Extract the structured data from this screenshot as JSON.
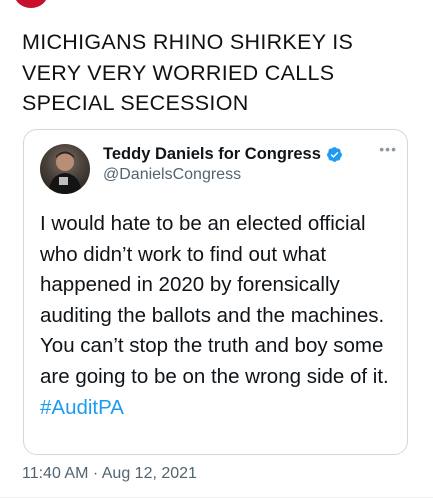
{
  "tweet": {
    "text": "Michigans RHINO Shirkey is very very worried calls special secession",
    "timestamp": "11:40 AM · Aug 12, 2021"
  },
  "quoted_tweet": {
    "display_name": "Teddy Daniels for Congress",
    "handle": "@DanielsCongress",
    "verified": true,
    "text_before_hashtag": "I would hate to be an elected official who didn’t work to find out what happened in 2020 by forensically auditing the ballots and the machines. You can’t stop the truth and boy some are going to be on the wrong side of it. ",
    "hashtag": "#AuditPA",
    "more_icon": "more-horizontal-icon",
    "verified_icon": "verified-badge-icon"
  },
  "colors": {
    "link": "#1d9bf0",
    "secondary_text": "#536471",
    "border": "#cfd9de"
  }
}
